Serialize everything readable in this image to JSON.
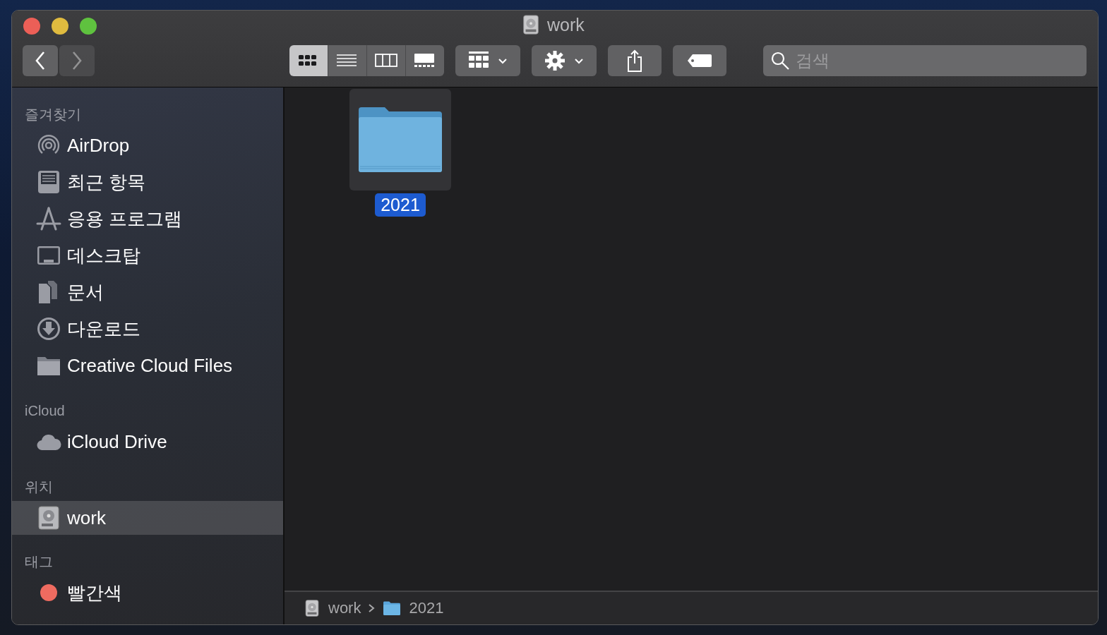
{
  "window": {
    "title": "work"
  },
  "toolbar": {
    "back": {
      "disabled": false
    },
    "forward": {
      "disabled": true
    },
    "view_modes": [
      {
        "selected": true
      },
      {
        "selected": false
      },
      {
        "selected": false
      },
      {
        "selected": false
      }
    ],
    "search": {
      "placeholder": "검색"
    }
  },
  "sidebar": {
    "sections": [
      {
        "heading": "즐겨찾기",
        "items": [
          {
            "label": "AirDrop",
            "selected": false
          },
          {
            "label": "최근 항목",
            "selected": false
          },
          {
            "label": "응용 프로그램",
            "selected": false
          },
          {
            "label": "데스크탑",
            "selected": false
          },
          {
            "label": "문서",
            "selected": false
          },
          {
            "label": "다운로드",
            "selected": false
          },
          {
            "label": "Creative Cloud Files",
            "selected": false
          }
        ]
      },
      {
        "heading": "iCloud",
        "items": [
          {
            "label": "iCloud Drive",
            "selected": false
          }
        ]
      },
      {
        "heading": "위치",
        "items": [
          {
            "label": "work",
            "selected": true
          }
        ]
      },
      {
        "heading": "태그",
        "items": [
          {
            "label": "빨간색",
            "selected": false,
            "color": "#ee6b60"
          }
        ]
      }
    ]
  },
  "files": [
    {
      "name": "2021",
      "selected": true
    }
  ],
  "path_bar": [
    {
      "label": "work"
    },
    {
      "label": "2021"
    }
  ]
}
